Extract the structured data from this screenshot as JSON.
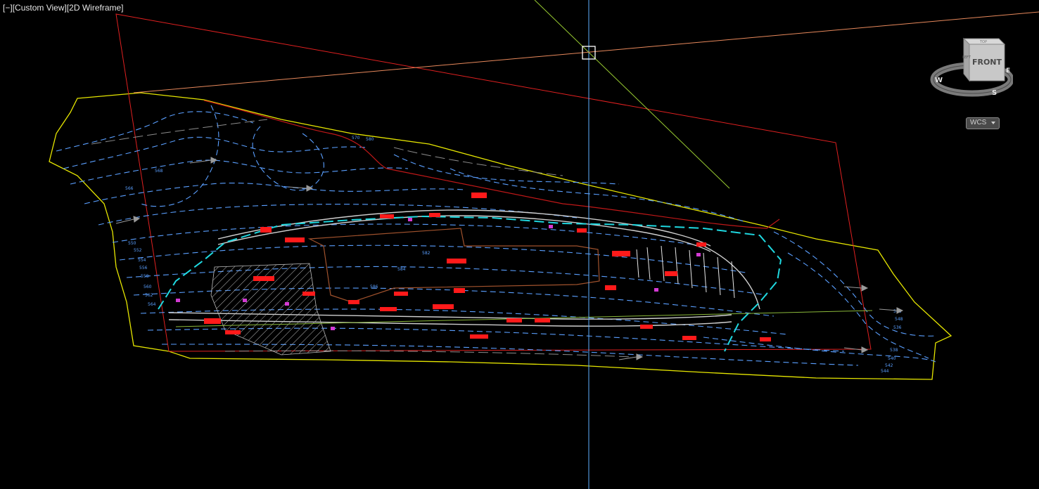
{
  "viewport": {
    "controls_label": "[−]",
    "view_label": "[Custom View]",
    "style_label": "[2D Wireframe]"
  },
  "viewcube": {
    "face_label": "FRONT",
    "top_label": "TOP",
    "side_label": "LEFT",
    "compass": {
      "west": "W",
      "south": "S",
      "east": "E"
    }
  },
  "ucs": {
    "label": "WCS"
  },
  "drawing": {
    "elevation_labels": [
      "550",
      "552",
      "554",
      "556",
      "558",
      "560",
      "562",
      "564",
      "566",
      "568",
      "570",
      "580",
      "582",
      "584",
      "586",
      "536",
      "538",
      "540",
      "542",
      "544",
      "546",
      "548"
    ]
  },
  "colors": {
    "background": "#000000",
    "boundary": "#e6e600",
    "contours": "#5a9fff",
    "property_line": "#ff1a1a",
    "hatch": "#c8c8c8",
    "cursor_vertical": "#5fb0ff",
    "cursor_diagonal": "#9acd32",
    "cursor_orange": "#e8895c"
  }
}
